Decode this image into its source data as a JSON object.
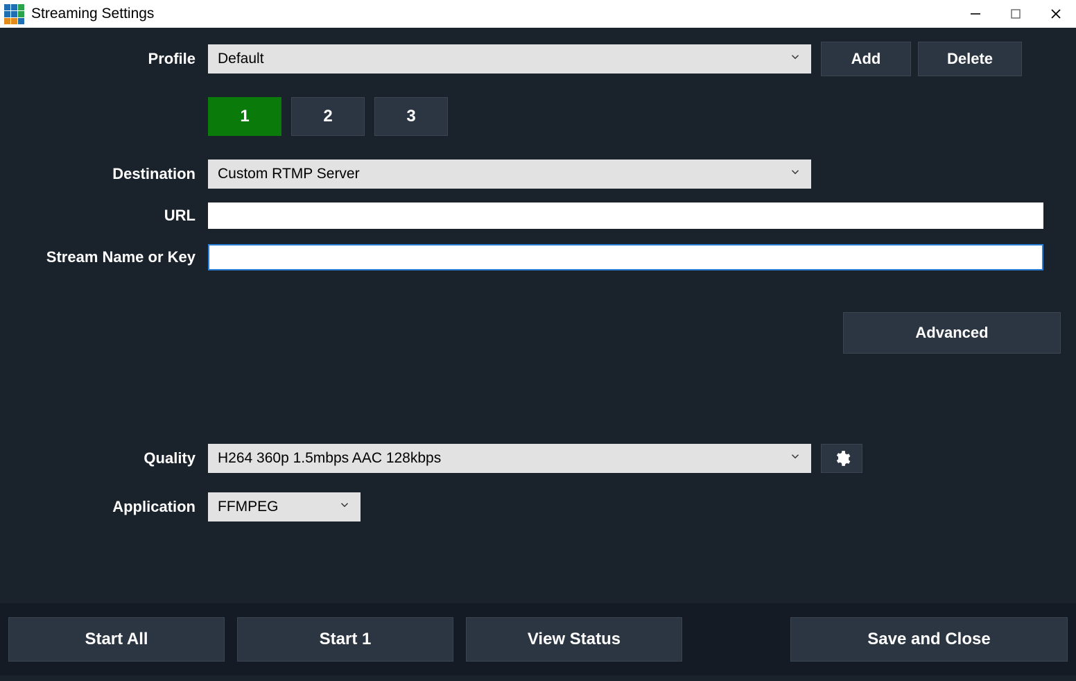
{
  "window": {
    "title": "Streaming Settings"
  },
  "profile": {
    "label": "Profile",
    "selected": "Default",
    "add_label": "Add",
    "delete_label": "Delete"
  },
  "tabs": [
    {
      "label": "1",
      "active": true
    },
    {
      "label": "2",
      "active": false
    },
    {
      "label": "3",
      "active": false
    }
  ],
  "destination": {
    "label": "Destination",
    "selected": "Custom RTMP Server"
  },
  "url": {
    "label": "URL",
    "value": ""
  },
  "streamkey": {
    "label": "Stream Name or Key",
    "value": ""
  },
  "advanced_label": "Advanced",
  "quality": {
    "label": "Quality",
    "selected": "H264 360p 1.5mbps AAC 128kbps"
  },
  "application": {
    "label": "Application",
    "selected": "FFMPEG"
  },
  "footer": {
    "start_all": "Start All",
    "start_1": "Start 1",
    "view_status": "View Status",
    "save_close": "Save and Close"
  },
  "icon_colors": {
    "titlebar_grid": [
      "#1f6fb2",
      "#1f6fb2",
      "#2aa34a",
      "#1f6fb2",
      "#1f6fb2",
      "#2aa34a",
      "#e28a1b",
      "#e28a1b",
      "#1f6fb2"
    ]
  }
}
